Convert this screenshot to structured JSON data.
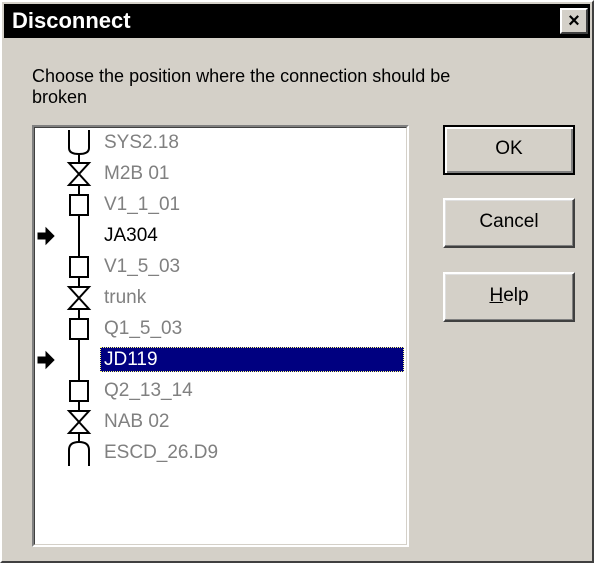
{
  "window": {
    "title": "Disconnect",
    "close_label": "×"
  },
  "instruction": "Choose the position where the connection should be broken",
  "list": {
    "items": [
      {
        "label": "SYS2.18",
        "state": "disabled",
        "symbol": "top-cap"
      },
      {
        "label": "M2B 01",
        "state": "disabled",
        "symbol": "bowtie"
      },
      {
        "label": "V1_1_01",
        "state": "disabled",
        "symbol": "box"
      },
      {
        "label": "JA304",
        "state": "enabled",
        "symbol": "line",
        "marker": "arrow"
      },
      {
        "label": "V1_5_03",
        "state": "disabled",
        "symbol": "box"
      },
      {
        "label": "trunk",
        "state": "disabled",
        "symbol": "bowtie"
      },
      {
        "label": "Q1_5_03",
        "state": "disabled",
        "symbol": "box"
      },
      {
        "label": "JD119",
        "state": "selected",
        "symbol": "line",
        "marker": "arrow"
      },
      {
        "label": "Q2_13_14",
        "state": "disabled",
        "symbol": "box"
      },
      {
        "label": "NAB 02",
        "state": "disabled",
        "symbol": "bowtie"
      },
      {
        "label": "ESCD_26.D9",
        "state": "disabled",
        "symbol": "bottom-cap"
      }
    ]
  },
  "buttons": {
    "ok": "OK",
    "cancel": "Cancel",
    "help_mnemonic": "H",
    "help_rest": "elp"
  },
  "colors": {
    "face": "#d4d0c8",
    "titlebar": "#000000",
    "selection": "#000080",
    "disabled_text": "#808080"
  }
}
